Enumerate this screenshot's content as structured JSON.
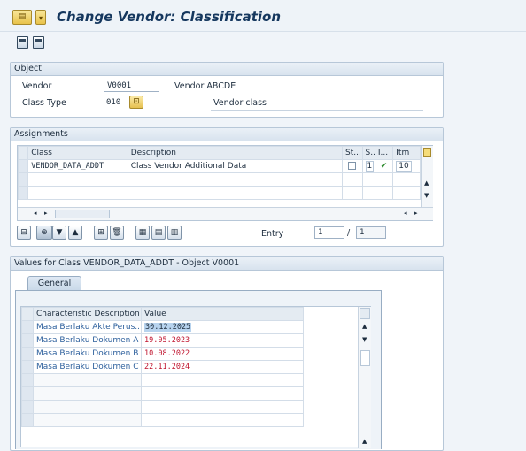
{
  "header": {
    "title": "Change Vendor: Classification"
  },
  "object_group": {
    "heading": "Object",
    "vendor_label": "Vendor",
    "vendor_value": "V0001",
    "vendor_name": "Vendor ABCDE",
    "class_type_label": "Class Type",
    "class_type_value": "010",
    "class_type_text": "Vendor class"
  },
  "assignments": {
    "heading": "Assignments",
    "columns": {
      "class": "Class",
      "description": "Description",
      "status": "St...",
      "s": "S..",
      "i": "I...",
      "itm": "Itm"
    },
    "rows": [
      {
        "class": "VENDOR_DATA_ADDT",
        "description": "Class Vendor Additional Data",
        "s": "1",
        "itm": "10"
      }
    ],
    "entry_label": "Entry",
    "entry_value": "1",
    "entry_total": "1"
  },
  "values": {
    "heading": "Values for Class VENDOR_DATA_ADDT - Object V0001",
    "tab_general": "General",
    "columns": {
      "char": "Characteristic Description",
      "value": "Value"
    },
    "rows": [
      {
        "char": "Masa Berlaku Akte Perus..",
        "value": "30.12.2025"
      },
      {
        "char": "Masa Berlaku Dokumen A",
        "value": "19.05.2023"
      },
      {
        "char": "Masa Berlaku Dokumen B",
        "value": "10.08.2022"
      },
      {
        "char": "Masa Berlaku Dokumen C",
        "value": "22.11.2024"
      }
    ]
  },
  "colors": {
    "title": "#15375e",
    "link": "#2c5f9c",
    "value_red": "#c0152f",
    "check": "#2e8b2e"
  }
}
